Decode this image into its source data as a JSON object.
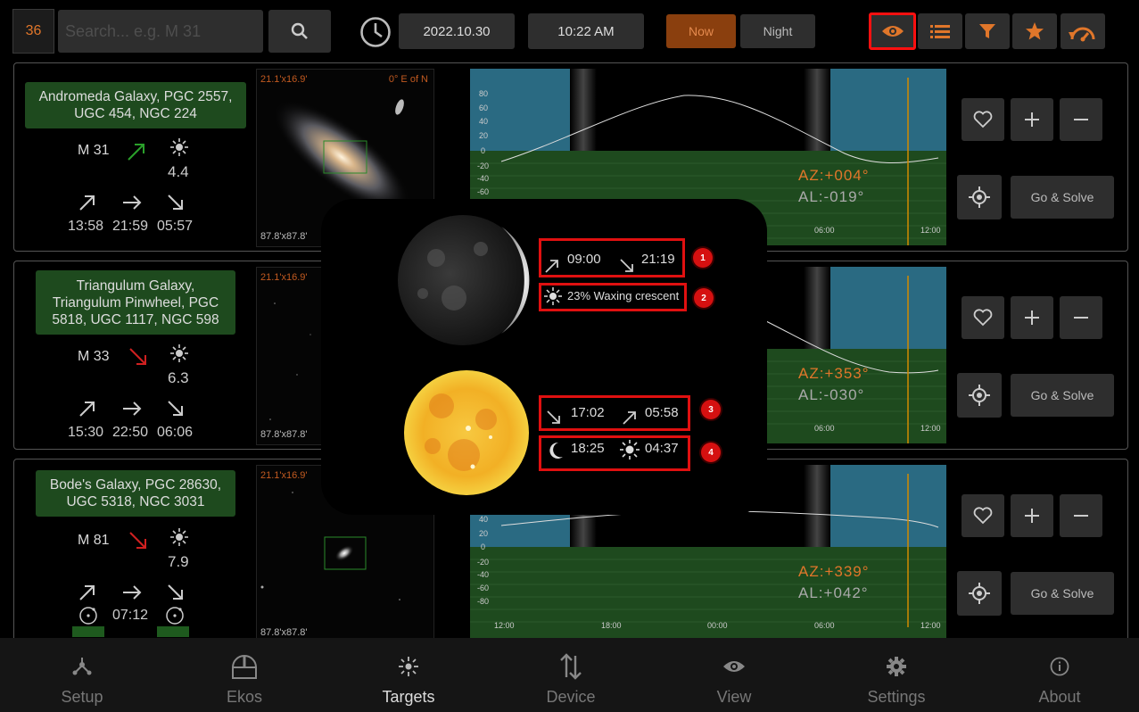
{
  "topbar": {
    "count": "36",
    "search_placeholder": "Search... e.g. M 31",
    "date": "2022.10.30",
    "time": "10:22 AM",
    "now_label": "Now",
    "night_label": "Night"
  },
  "cards": [
    {
      "name": "Andromeda Galaxy, PGC 2557, UGC 454, NGC 224",
      "designation": "M 31",
      "trend": "rising",
      "magnitude": "4.4",
      "rise": "13:58",
      "transit": "21:59",
      "set": "05:57",
      "fov": "21.1'x16.9'",
      "rotation": "0° E of N",
      "size": "87.8'x87.8'",
      "az": "AZ:+004°",
      "al": "AL:-019°",
      "chart_ticks": [
        "80",
        "60",
        "40",
        "20",
        "0",
        "-20",
        "-40",
        "-60"
      ],
      "x_ticks": [
        "06:00",
        "12:00"
      ]
    },
    {
      "name": "Triangulum Galaxy, Triangulum Pinwheel, PGC 5818, UGC 1117, NGC 598",
      "designation": "M 33",
      "trend": "setting",
      "magnitude": "6.3",
      "rise": "15:30",
      "transit": "22:50",
      "set": "06:06",
      "fov": "21.1'x16.9'",
      "size": "87.8'x87.8'",
      "az": "AZ:+353°",
      "al": "AL:-030°",
      "x_ticks": [
        "06:00",
        "12:00"
      ]
    },
    {
      "name": "Bode's Galaxy, PGC 28630, UGC 5318, NGC 3031",
      "designation": "M 81",
      "trend": "setting",
      "magnitude": "7.9",
      "transit": "07:12",
      "fov": "21.1'x16.9'",
      "size": "87.8'x87.8'",
      "az": "AZ:+339°",
      "al": "AL:+042°",
      "chart_ticks": [
        "40",
        "20",
        "0",
        "-20",
        "-40",
        "-60",
        "-80"
      ],
      "x_ticks": [
        "12:00",
        "18:00",
        "00:00",
        "06:00",
        "12:00"
      ]
    }
  ],
  "card_actions": {
    "go_solve": "Go & Solve"
  },
  "popup": {
    "moon_rise": "09:00",
    "moon_set": "21:19",
    "moon_phase": "23% Waxing crescent",
    "sun_set": "17:02",
    "sun_rise": "05:58",
    "dusk": "18:25",
    "dawn": "04:37",
    "badges": [
      "1",
      "2",
      "3",
      "4"
    ]
  },
  "bottomnav": [
    {
      "label": "Setup",
      "icon": "setup-icon"
    },
    {
      "label": "Ekos",
      "icon": "ekos-icon"
    },
    {
      "label": "Targets",
      "icon": "targets-icon"
    },
    {
      "label": "Device",
      "icon": "device-icon"
    },
    {
      "label": "View",
      "icon": "view-icon"
    },
    {
      "label": "Settings",
      "icon": "settings-icon"
    },
    {
      "label": "About",
      "icon": "about-icon"
    }
  ],
  "colors": {
    "accent": "#e0762a",
    "name_bg": "#1e4a1e",
    "highlight": "#e01010",
    "sky_blue": "#2a6a82",
    "ground_green": "#1e4a1e"
  }
}
